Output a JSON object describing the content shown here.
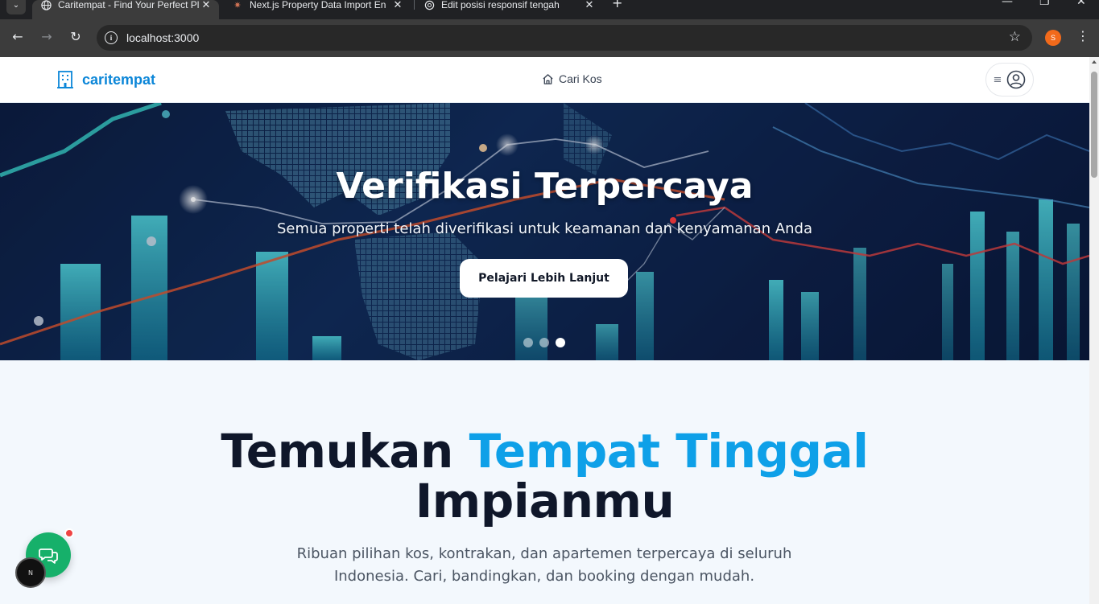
{
  "browser": {
    "tabs": [
      {
        "title": "Caritempat - Find Your Perfect Pl",
        "active": true
      },
      {
        "title": "Next.js Property Data Import En",
        "active": false
      },
      {
        "title": "Edit posisi responsif tengah",
        "active": false
      }
    ],
    "url": "localhost:3000",
    "profile_initial": "S"
  },
  "header": {
    "brand": "caritempat",
    "nav_label": "Cari Kos"
  },
  "hero": {
    "title": "Verifikasi Terpercaya",
    "subtitle": "Semua properti telah diverifikasi untuk keamanan dan kenyamanan Anda",
    "cta": "Pelajari Lebih Lanjut",
    "slides_total": 3,
    "active_slide": 3
  },
  "main": {
    "headline_part1": "Temukan",
    "headline_accent": "Tempat Tinggal",
    "headline_part2": "Impianmu",
    "lead": "Ribuan pilihan kos, kontrakan, dan apartemen terpercaya di seluruh Indonesia. Cari, bandingkan, dan booking dengan mudah."
  },
  "colors": {
    "brand": "#0b86d8",
    "accent": "#0ea0e8",
    "chat": "#16b06a"
  }
}
